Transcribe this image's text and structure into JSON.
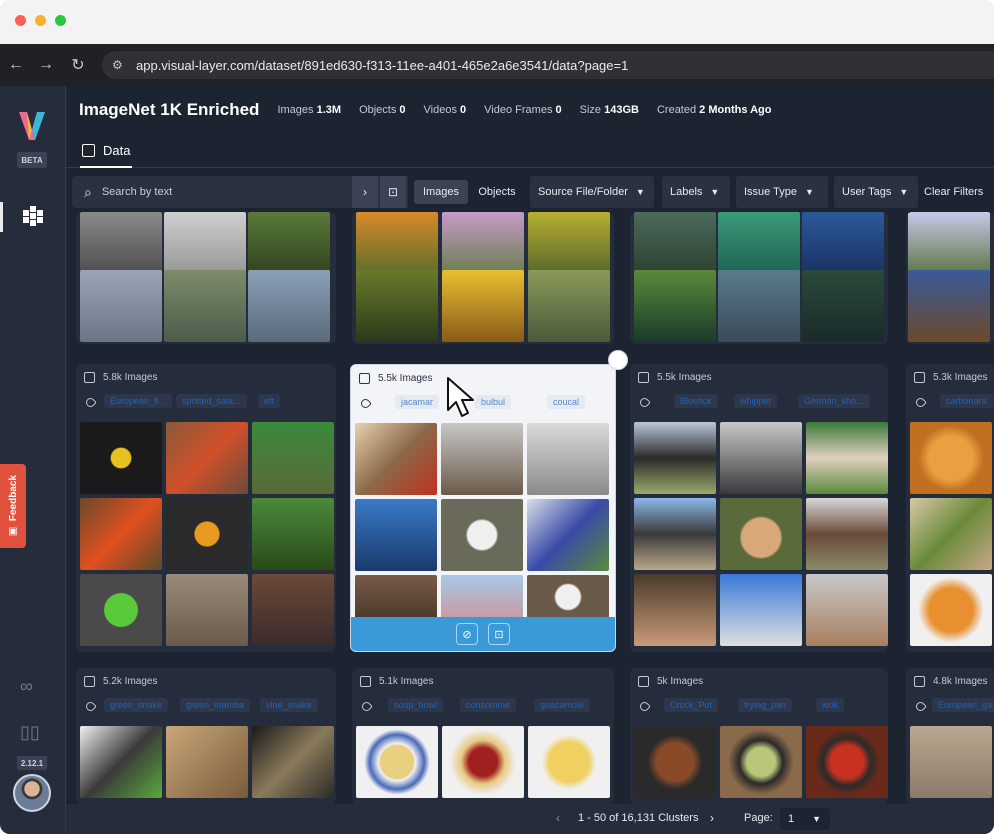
{
  "browser": {
    "url": "app.visual-layer.com/dataset/891ed630-f313-11ee-a401-465e2a6e3541/data?page=1",
    "back_icon": "arrow-left-icon",
    "forward_icon": "arrow-right-icon",
    "reload_icon": "reload-icon",
    "site_settings_icon": "sliders-icon"
  },
  "leftnav": {
    "beta": "BETA",
    "feedback": "Feedback",
    "version": "2.12.1"
  },
  "header": {
    "title": "ImageNet 1K Enriched",
    "stats": [
      {
        "label": "Images",
        "value": "1.3M"
      },
      {
        "label": "Objects",
        "value": "0"
      },
      {
        "label": "Videos",
        "value": "0"
      },
      {
        "label": "Video Frames",
        "value": "0"
      },
      {
        "label": "Size",
        "value": "143GB"
      },
      {
        "label": "Created",
        "value": "2 Months Ago"
      }
    ]
  },
  "tabs": {
    "data": "Data"
  },
  "filters": {
    "search_placeholder": "Search by text",
    "images": "Images",
    "objects": "Objects",
    "source": "Source File/Folder",
    "labels": "Labels",
    "issue_type": "Issue Type",
    "user_tags": "User Tags",
    "clear": "Clear Filters"
  },
  "clusters": [
    {
      "count": "5.8k Images",
      "labels": [
        "European_fi...",
        "spotted_sala...",
        "eft"
      ]
    },
    {
      "count": "5.5k Images",
      "labels": [
        "jacamar",
        "bulbul",
        "coucal"
      ]
    },
    {
      "count": "5.5k Images",
      "labels": [
        "Bluetick",
        "whippet",
        "German_sho..."
      ]
    },
    {
      "count": "5.3k Images",
      "labels": [
        "carbonara"
      ]
    },
    {
      "count": "5.2k Images",
      "labels": [
        "green_snake",
        "green_mamba",
        "vine_snake"
      ]
    },
    {
      "count": "5.1k Images",
      "labels": [
        "soup_bowl",
        "consomme",
        "guacamole"
      ]
    },
    {
      "count": "5k Images",
      "labels": [
        "Crock_Pot",
        "frying_pan",
        "wok"
      ]
    },
    {
      "count": "4.8k Images",
      "labels": [
        "European_ga..."
      ]
    }
  ],
  "pager": {
    "range": "1 - 50 of 16,131 Clusters",
    "page_label": "Page:",
    "page_value": "1"
  }
}
